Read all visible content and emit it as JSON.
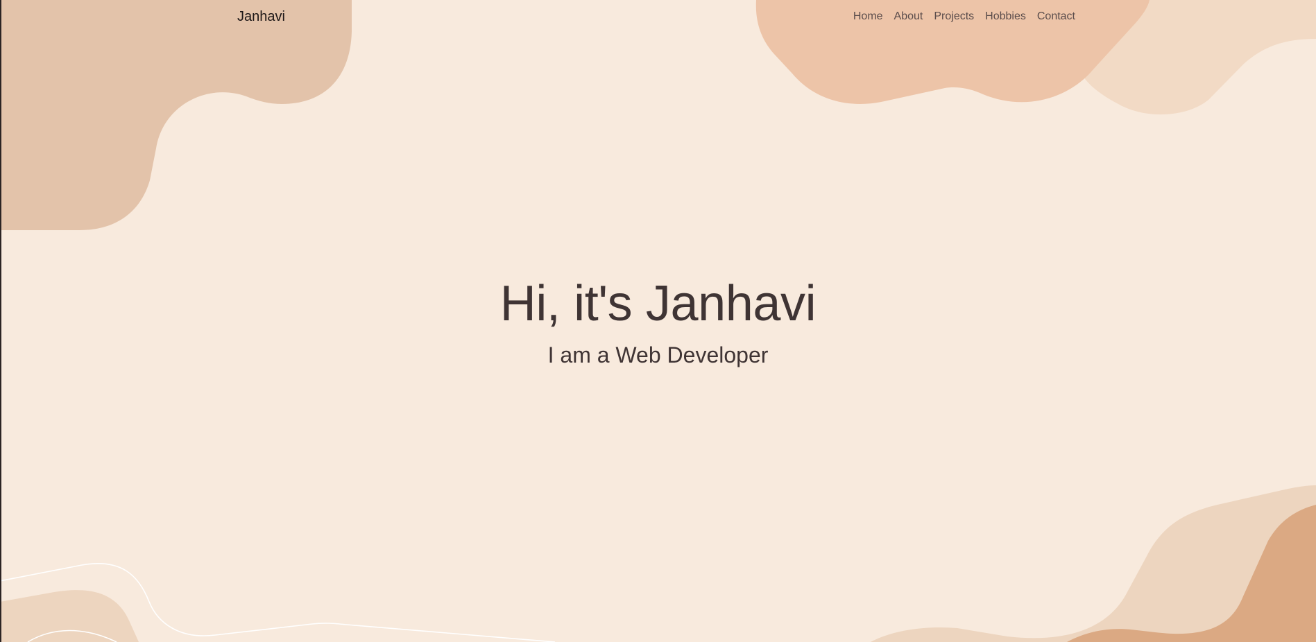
{
  "brand": {
    "name": "Janhavi"
  },
  "nav": {
    "items": [
      {
        "label": "Home"
      },
      {
        "label": "About"
      },
      {
        "label": "Projects"
      },
      {
        "label": "Hobbies"
      },
      {
        "label": "Contact"
      }
    ]
  },
  "hero": {
    "title": "Hi, it's Janhavi",
    "subtitle": "I am a Web Developer"
  },
  "colors": {
    "background": "#f8eadd",
    "blob_top_left": "#e3c3aa",
    "blob_top_right": "#edc4a8",
    "blob_top_right_back": "#f2dac5",
    "blob_bottom_right": "#edd5bf",
    "blob_bottom_right_dark": "#dba983",
    "text": "#3f3434"
  }
}
